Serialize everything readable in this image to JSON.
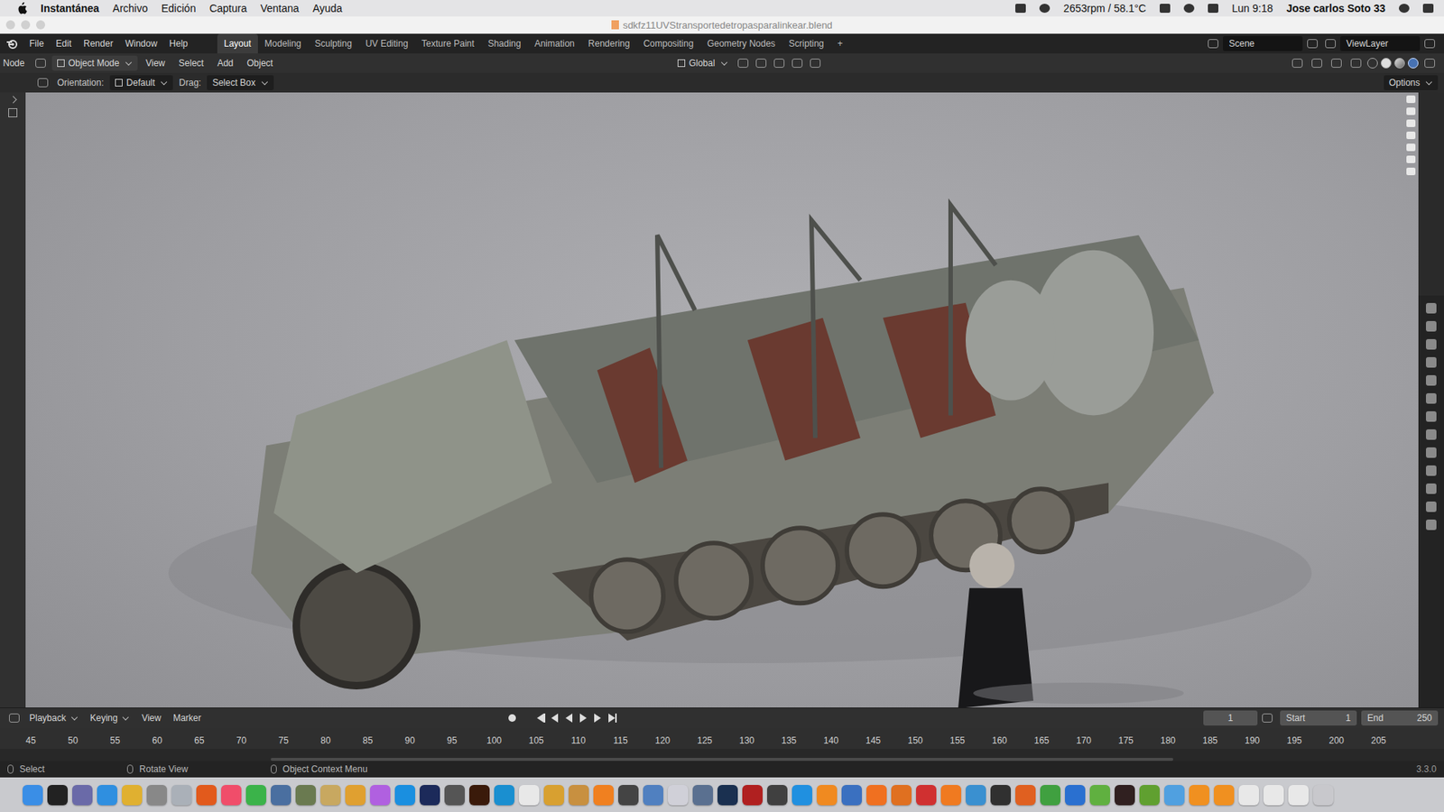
{
  "menubar": {
    "app": "Instantánea",
    "menus": [
      "Archivo",
      "Edición",
      "Captura",
      "Ventana",
      "Ayuda"
    ],
    "status": "2653rpm / 58.1°C",
    "clock": "Lun 9:18",
    "user": "Jose carlos Soto 33"
  },
  "window": {
    "title": "sdkfz11UVStransportedetropasparalinkear.blend"
  },
  "topbar": {
    "menus": [
      "File",
      "Edit",
      "Render",
      "Window",
      "Help"
    ],
    "workspaces": [
      {
        "label": "Layout",
        "selected": true
      },
      {
        "label": "Modeling",
        "selected": false
      },
      {
        "label": "Sculpting",
        "selected": false
      },
      {
        "label": "UV Editing",
        "selected": false
      },
      {
        "label": "Texture Paint",
        "selected": false
      },
      {
        "label": "Shading",
        "selected": false
      },
      {
        "label": "Animation",
        "selected": false
      },
      {
        "label": "Rendering",
        "selected": false
      },
      {
        "label": "Compositing",
        "selected": false
      },
      {
        "label": "Geometry Nodes",
        "selected": false
      },
      {
        "label": "Scripting",
        "selected": false
      }
    ],
    "add": "+",
    "scene": "Scene",
    "view_layer": "ViewLayer"
  },
  "header": {
    "editor": "Node",
    "mode": "Object Mode",
    "menus": [
      "View",
      "Select",
      "Add",
      "Object"
    ],
    "orientation": "Global"
  },
  "tool_settings": {
    "orientation_label": "Orientation:",
    "orientation": "Default",
    "drag_label": "Drag:",
    "drag": "Select Box",
    "options": "Options"
  },
  "timeline": {
    "menus": [
      "Playback",
      "Keying",
      "View",
      "Marker"
    ],
    "current_frame": "1",
    "start_label": "Start",
    "start": "1",
    "end_label": "End",
    "end": "250",
    "ticks": [
      "45",
      "50",
      "55",
      "60",
      "65",
      "70",
      "75",
      "80",
      "85",
      "90",
      "95",
      "100",
      "105",
      "110",
      "115",
      "120",
      "125",
      "130",
      "135",
      "140",
      "145",
      "150",
      "155",
      "160",
      "165",
      "170",
      "175",
      "180",
      "185",
      "190",
      "195",
      "200",
      "205"
    ]
  },
  "status_bar": {
    "items": [
      "Select",
      "Rotate View",
      "Object Context Menu"
    ],
    "version": "3.3.0"
  },
  "dock": {
    "apps": [
      {
        "color": "#3a8ee6"
      },
      {
        "color": "#222222"
      },
      {
        "color": "#6a6aa8"
      },
      {
        "color": "#2f8fe0"
      },
      {
        "color": "#e0b030"
      },
      {
        "color": "#888888"
      },
      {
        "color": "#aab0b8"
      },
      {
        "color": "#e25a1c"
      },
      {
        "color": "#f04d6a"
      },
      {
        "color": "#3bb34a"
      },
      {
        "color": "#4a6fa0"
      },
      {
        "color": "#6a7a50"
      },
      {
        "color": "#c8a860"
      },
      {
        "color": "#e0a030"
      },
      {
        "color": "#b060e0"
      },
      {
        "color": "#1a8fe0"
      },
      {
        "color": "#1c2a5a"
      },
      {
        "color": "#555555"
      },
      {
        "color": "#3a1a0a"
      },
      {
        "color": "#1a8fd0"
      },
      {
        "color": "#e8e8e8"
      },
      {
        "color": "#d8a030"
      },
      {
        "color": "#c89040"
      },
      {
        "color": "#f08020"
      },
      {
        "color": "#444444"
      },
      {
        "color": "#5080c0"
      },
      {
        "color": "#d0d0d8"
      },
      {
        "color": "#5a7090"
      },
      {
        "color": "#1a3050"
      },
      {
        "color": "#b02020"
      },
      {
        "color": "#404040"
      },
      {
        "color": "#2090e0"
      },
      {
        "color": "#f08a20"
      },
      {
        "color": "#3a70c0"
      },
      {
        "color": "#f07020"
      },
      {
        "color": "#e07020"
      },
      {
        "color": "#d03030"
      },
      {
        "color": "#f07a20"
      },
      {
        "color": "#3a90d0"
      },
      {
        "color": "#303030"
      },
      {
        "color": "#e06020"
      },
      {
        "color": "#40a040"
      },
      {
        "color": "#2a70d0"
      },
      {
        "color": "#60b040"
      },
      {
        "color": "#302020"
      },
      {
        "color": "#60a030"
      },
      {
        "color": "#50a0e0"
      },
      {
        "color": "#f09020"
      },
      {
        "color": "#f09020"
      },
      {
        "color": "#e8e8e8"
      },
      {
        "color": "#e8e8e8"
      },
      {
        "color": "#e8e8e8"
      },
      {
        "color": "#c8c8cc"
      }
    ]
  }
}
